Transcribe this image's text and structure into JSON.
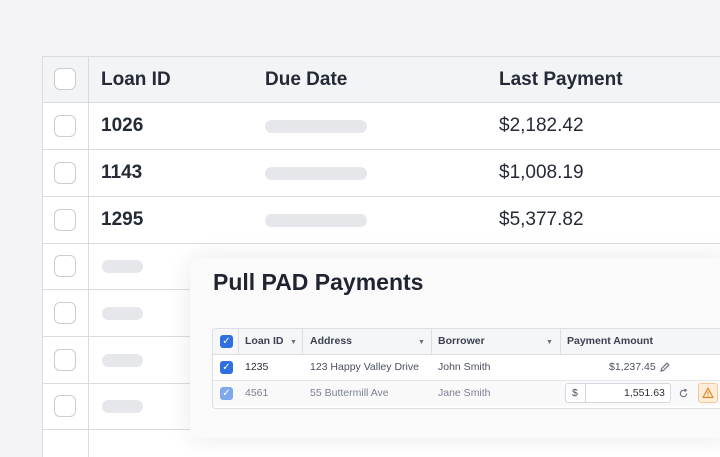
{
  "table": {
    "headers": [
      "Loan ID",
      "Due Date",
      "Last Payment"
    ],
    "rows": [
      {
        "loan_id": "1026",
        "last_payment": "$2,182.42"
      },
      {
        "loan_id": "1143",
        "last_payment": "$1,008.19"
      },
      {
        "loan_id": "1295",
        "last_payment": "$5,377.82"
      }
    ]
  },
  "dialog": {
    "title": "Pull PAD Payments",
    "columns": [
      "Loan ID",
      "Address",
      "Borrower",
      "Payment Amount"
    ],
    "rows": [
      {
        "loan_id": "1235",
        "address": "123 Happy Valley Drive",
        "borrower": "John Smith",
        "amount": "$1,237.45"
      },
      {
        "loan_id": "4561",
        "address": "55 Buttermill Ave",
        "borrower": "Jane Smith",
        "currency": "$",
        "amount_input": "1,551.63"
      }
    ]
  },
  "colors": {
    "accent": "#2f6fe0",
    "warning": "#e08a2a"
  }
}
